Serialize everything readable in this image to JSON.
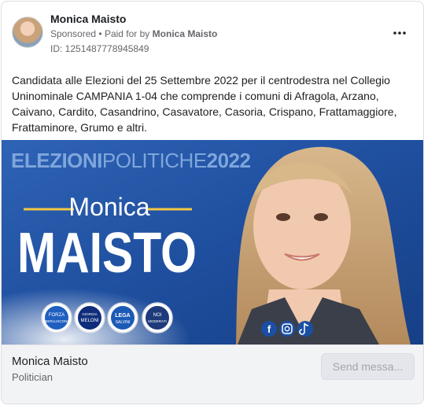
{
  "post": {
    "author": "Monica Maisto",
    "sponsored": "Sponsored",
    "paid_for_prefix": "Paid for by",
    "paid_for_by": "Monica Maisto",
    "ad_id": "ID: 1251487778945849",
    "text": "Candidata alle Elezioni del 25 Settembre 2022 per il centrodestra nel Collegio Uninominale CAMPANIA 1-04 che comprende i comuni di Afragola, Arzano, Caivano, Cardito, Casandrino, Casavatore, Casoria, Crispano, Frattamaggiore, Frattaminore, Grumo e altri."
  },
  "creative": {
    "banner_bold": "ELEZIONI",
    "banner_light": "POLITICHE",
    "banner_year": "2022",
    "first_name": "Monica",
    "last_name": "MAISTO",
    "logos": [
      {
        "top": "FORZA",
        "bottom": "BERLUSCONI",
        "color": "#1f5fbf",
        "icon": "forza-italia-logo"
      },
      {
        "top": "GIORGIA",
        "bottom": "MELONI",
        "color": "#0f2d7a",
        "icon": "fratelli-italia-logo"
      },
      {
        "top": "LEGA",
        "bottom": "SALVINI",
        "color": "#1c5bb5",
        "icon": "lega-logo"
      },
      {
        "top": "NOI",
        "bottom": "MODERATI",
        "color": "#1e3a7b",
        "icon": "noi-moderati-logo"
      }
    ],
    "social_icons": [
      "facebook-icon",
      "instagram-icon",
      "tiktok-icon"
    ]
  },
  "footer": {
    "page_name": "Monica Maisto",
    "page_category": "Politician",
    "cta_label": "Send messa..."
  }
}
